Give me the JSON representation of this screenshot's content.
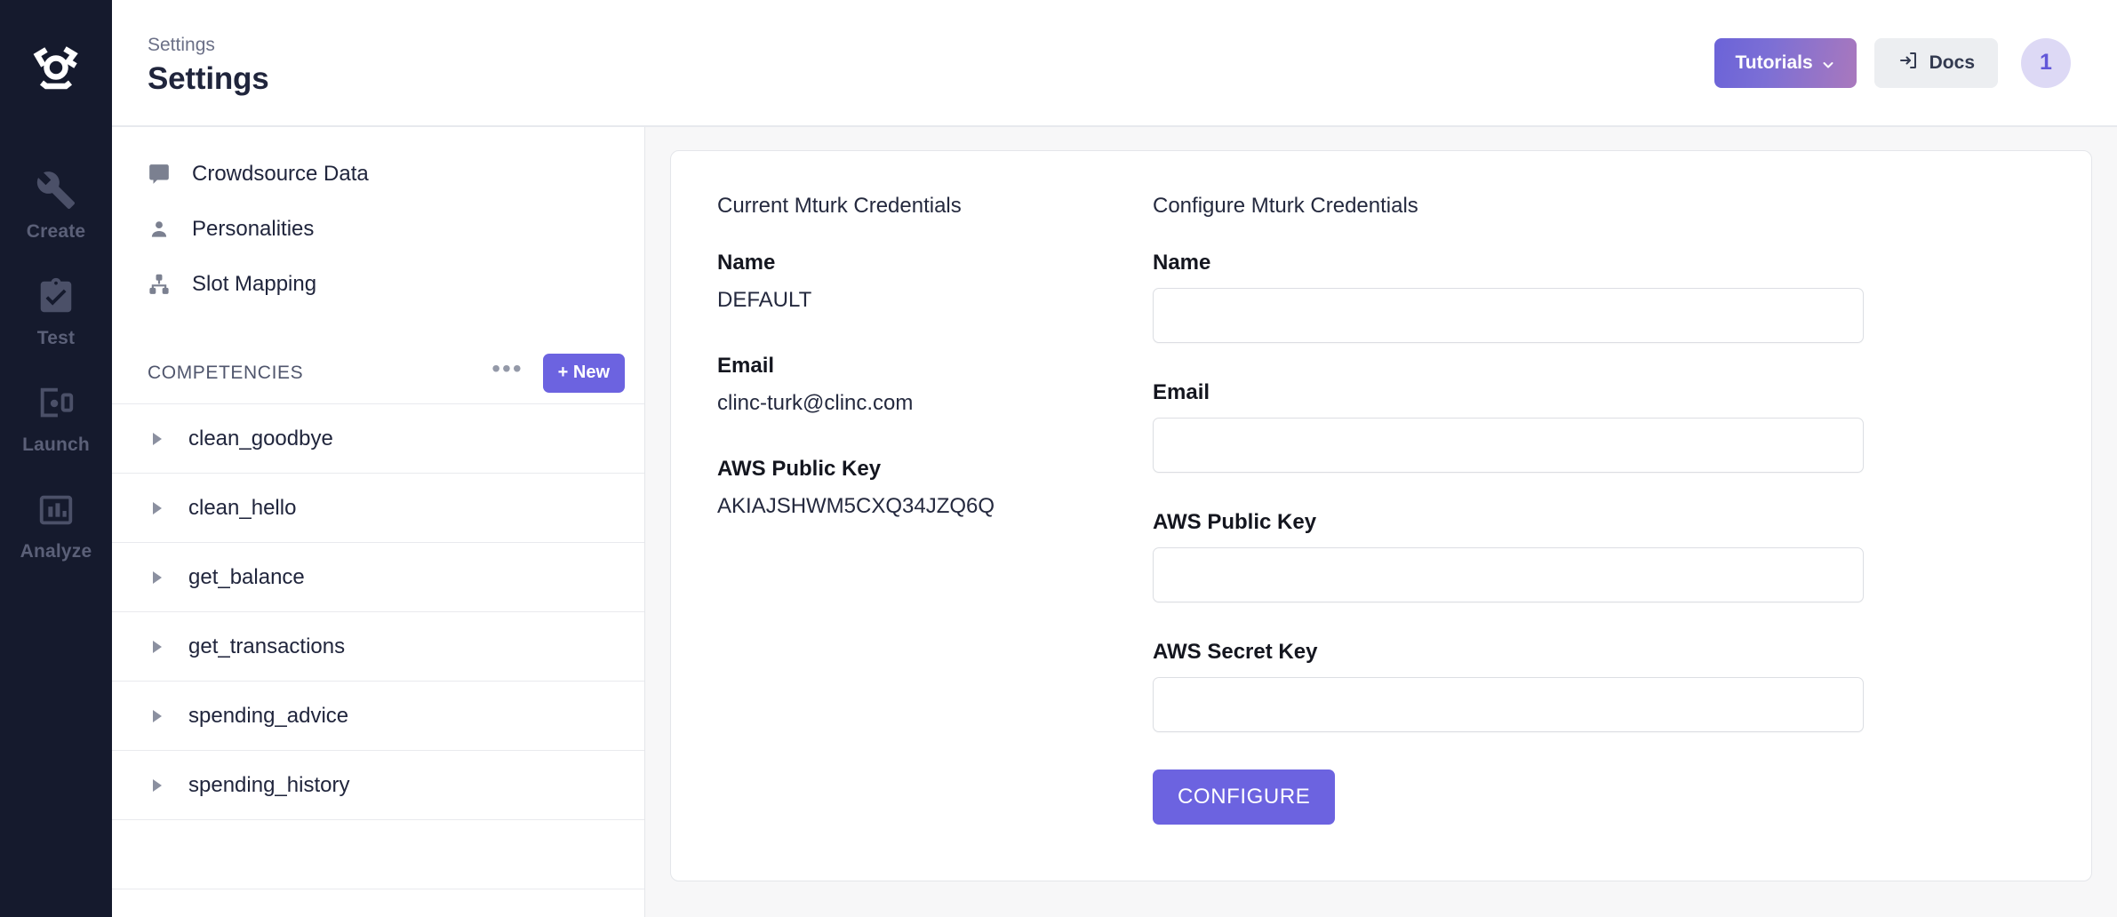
{
  "rail": {
    "logo_icon": "clinc-face-logo-icon",
    "items": [
      {
        "label": "Create",
        "icon": "wrench-icon"
      },
      {
        "label": "Test",
        "icon": "clipboard-check-icon"
      },
      {
        "label": "Launch",
        "icon": "launch-window-icon"
      },
      {
        "label": "Analyze",
        "icon": "bar-chart-icon"
      }
    ]
  },
  "header": {
    "breadcrumb": "Settings",
    "title": "Settings",
    "tutorials_label": "Tutorials",
    "docs_label": "Docs",
    "badge_count": "1",
    "accent_color": "#6c63e0",
    "badge_bg": "#ddd9f5"
  },
  "panel": {
    "nav_items": [
      {
        "label": "Crowdsource Data",
        "icon": "forum-icon"
      },
      {
        "label": "Personalities",
        "icon": "person-icon"
      },
      {
        "label": "Slot Mapping",
        "icon": "account-tree-icon"
      }
    ],
    "section": {
      "title": "COMPETENCIES",
      "overflow_label": "•••",
      "new_label": "+ New"
    },
    "competencies": [
      {
        "name": "clean_goodbye"
      },
      {
        "name": "clean_hello"
      },
      {
        "name": "get_balance"
      },
      {
        "name": "get_transactions"
      },
      {
        "name": "spending_advice"
      },
      {
        "name": "spending_history"
      }
    ]
  },
  "content": {
    "current": {
      "heading": "Current Mturk Credentials",
      "fields": [
        {
          "label": "Name",
          "value": "DEFAULT"
        },
        {
          "label": "Email",
          "value": "clinc-turk@clinc.com"
        },
        {
          "label": "AWS Public Key",
          "value": "AKIAJSHWM5CXQ34JZQ6Q"
        }
      ]
    },
    "configure": {
      "heading": "Configure Mturk Credentials",
      "fields": [
        {
          "label": "Name",
          "value": "",
          "placeholder": ""
        },
        {
          "label": "Email",
          "value": "",
          "placeholder": ""
        },
        {
          "label": "AWS Public Key",
          "value": "",
          "placeholder": ""
        },
        {
          "label": "AWS Secret Key",
          "value": "",
          "placeholder": ""
        }
      ],
      "submit_label": "CONFIGURE"
    }
  }
}
